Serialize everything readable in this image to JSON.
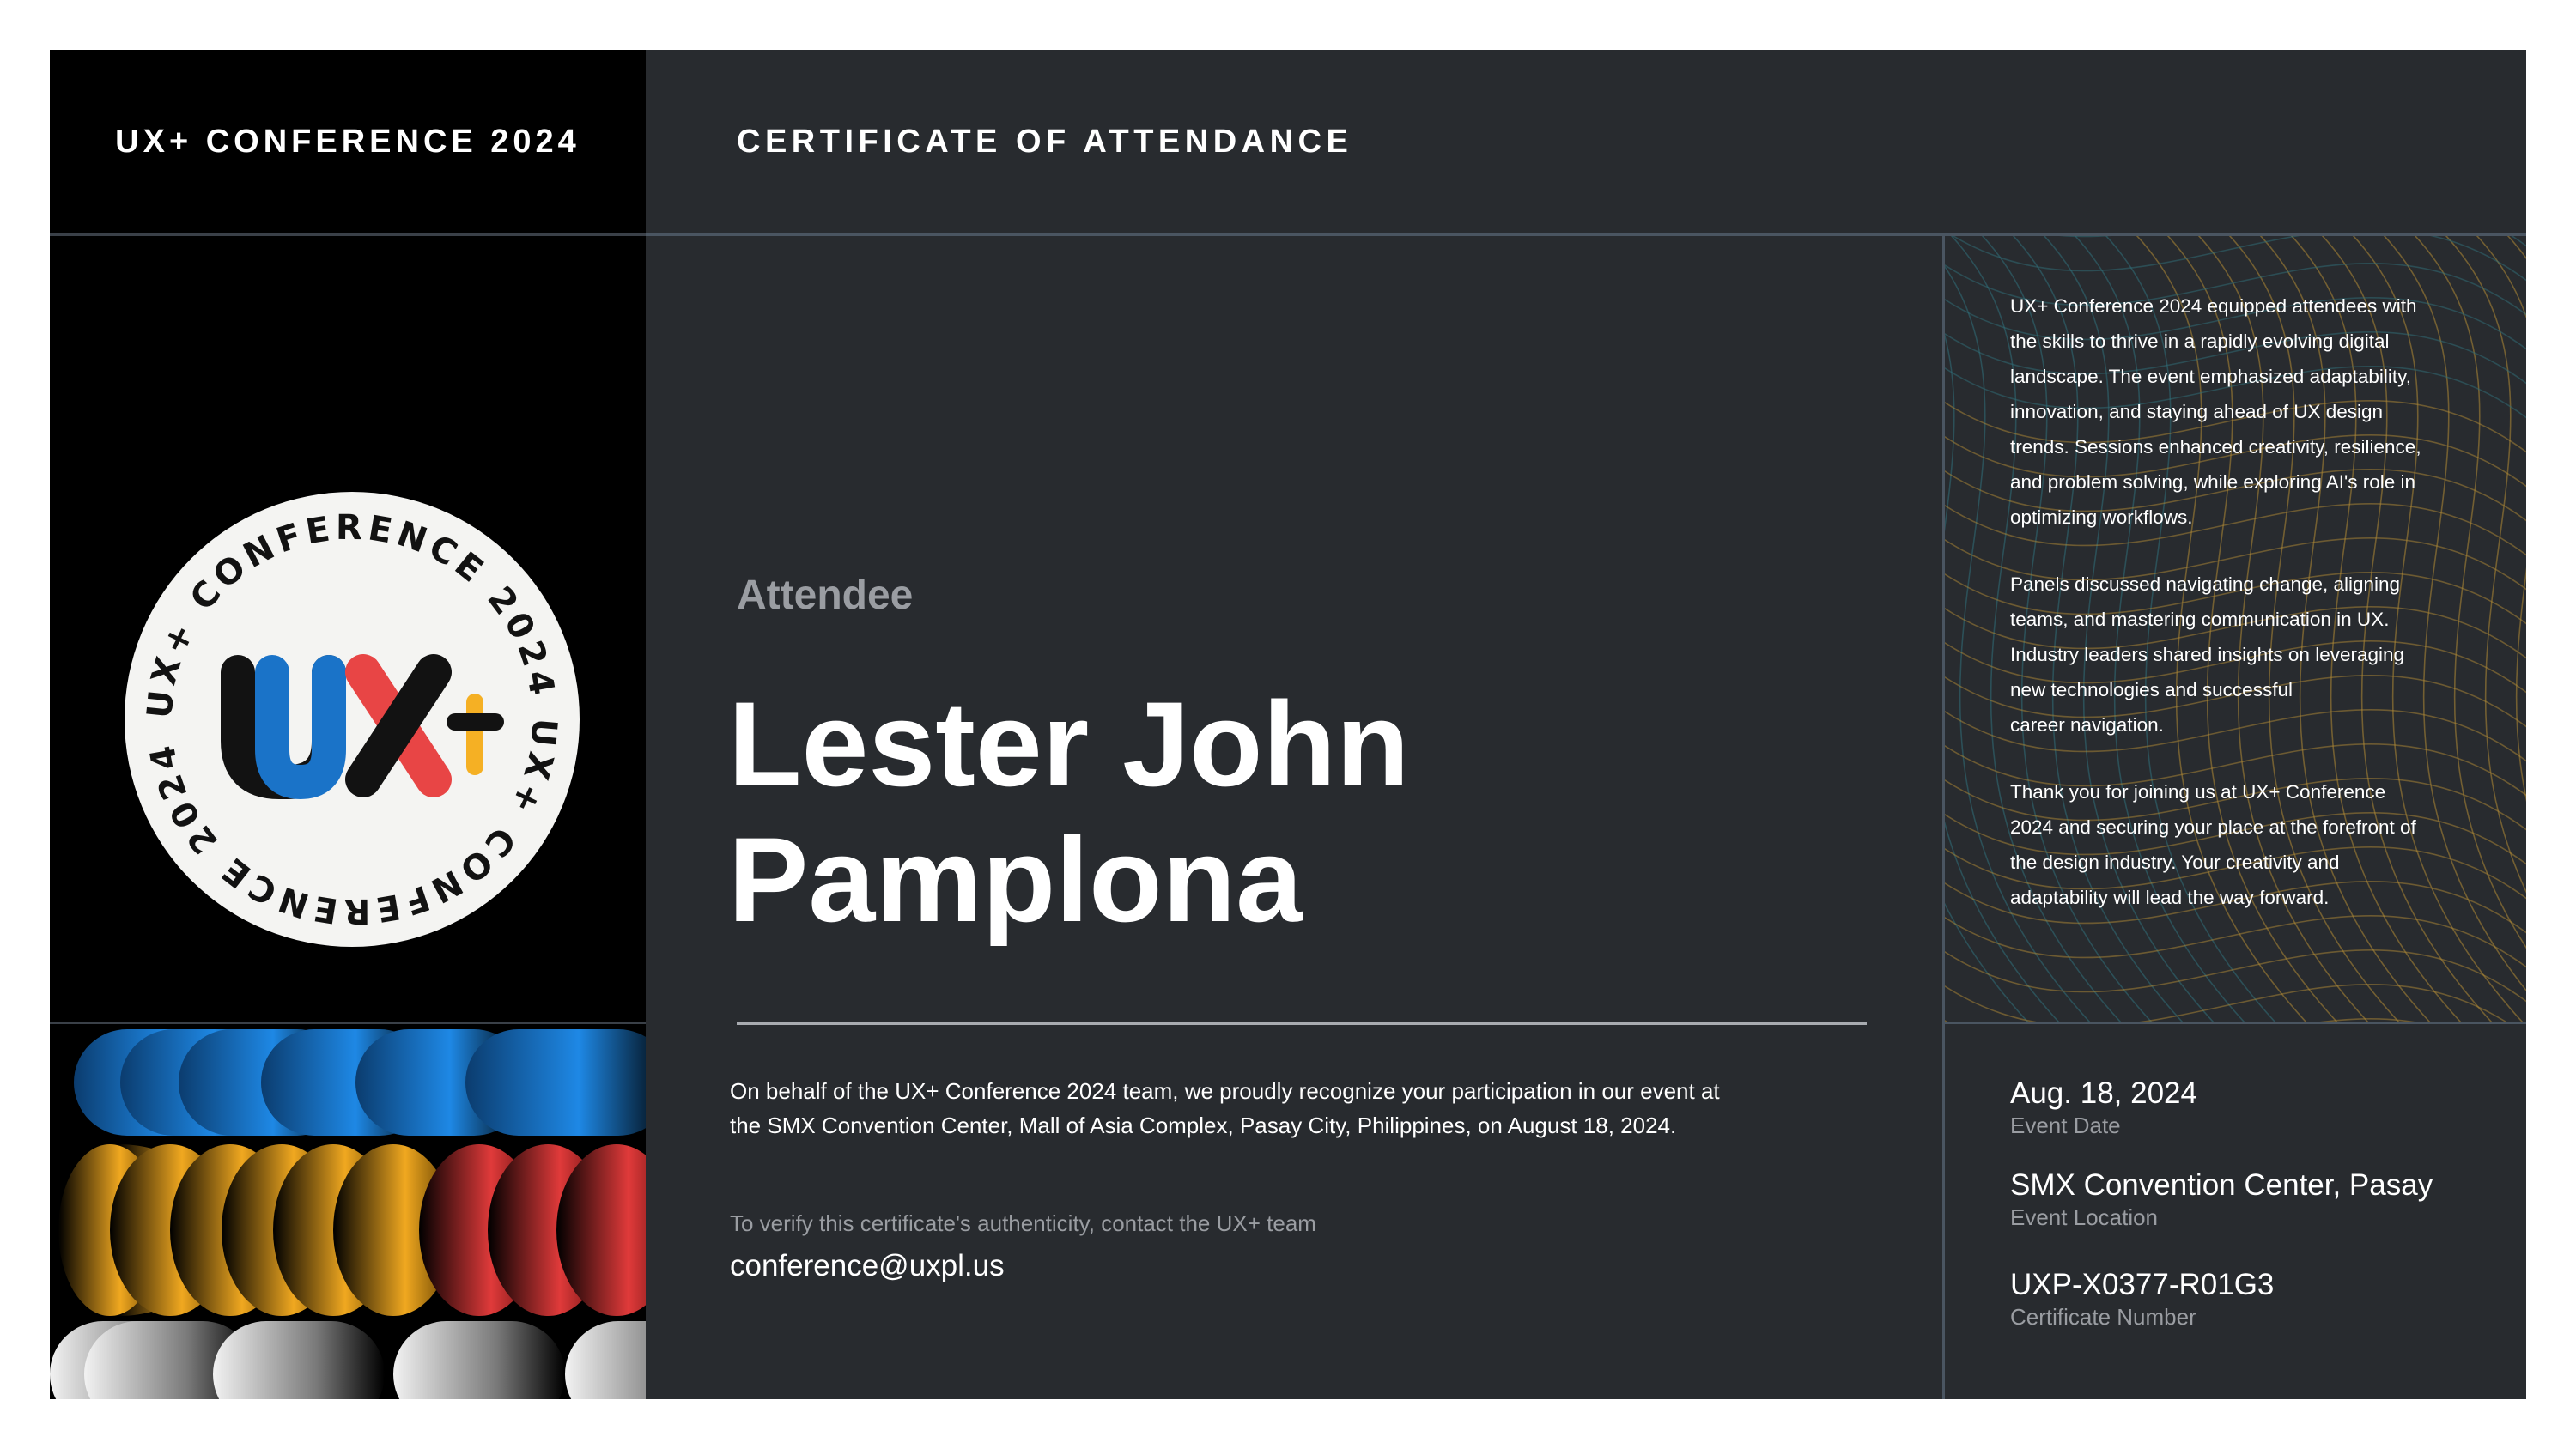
{
  "header": {
    "conference_title": "UX+ CONFERENCE 2024",
    "certificate_title": "CERTIFICATE OF ATTENDANCE"
  },
  "badge": {
    "ring_text": "UX+ CONFERENCE 2024 UX+ CONFERENCE 2024 ",
    "logo_text": "UX+",
    "colors": {
      "u": "#1a73c8",
      "x_red": "#e84545",
      "plus": "#f5b024",
      "dark": "#121212",
      "bg": "#f4f4f2"
    }
  },
  "recipient": {
    "label": "Attendee",
    "name_line1": "Lester John",
    "name_line2": "Pamplona"
  },
  "body": {
    "recognition_line1": "On behalf of the UX+ Conference 2024 team, we proudly recognize your participation in our event at",
    "recognition_line2": "the SMX Convention Center, Mall of Asia Complex, Pasay City, Philippines, on August 18, 2024.",
    "verify_text": "To verify this certificate's authenticity, contact the UX+ team",
    "email": "conference@uxpl.us"
  },
  "sidebar": {
    "paragraphs": [
      {
        "lines": [
          "UX+ Conference 2024 equipped attendees with",
          "the skills to thrive in a rapidly evolving digital",
          "landscape. The event emphasized adaptability,",
          "innovation, and staying ahead of UX design",
          "trends. Sessions enhanced creativity, resilience,",
          "and problem solving, while exploring AI's role in",
          "optimizing workflows."
        ]
      },
      {
        "lines": [
          "Panels discussed navigating change, aligning",
          "teams, and mastering communication in UX.",
          "Industry leaders shared insights on leveraging",
          "new technologies and successful",
          "career navigation."
        ]
      },
      {
        "lines": [
          "Thank you for joining us at UX+ Conference",
          "2024 and securing your place at the forefront of",
          "the design industry. Your creativity and",
          "adaptability will lead the way forward."
        ]
      }
    ]
  },
  "details": {
    "event_date": {
      "value": "Aug. 18, 2024",
      "label": "Event Date"
    },
    "event_location": {
      "value": "SMX Convention Center, Pasay",
      "label": "Event Location"
    },
    "certificate_number": {
      "value": "UXP-X0377-R01G3",
      "label": "Certificate Number"
    }
  },
  "colors": {
    "panel_bg": "#282b2f",
    "left_bg": "#000000",
    "divider": "#4a5561",
    "muted_text": "#9a9da2",
    "mesh_teal": "#2f6f7a",
    "mesh_gold": "#b08a35"
  }
}
